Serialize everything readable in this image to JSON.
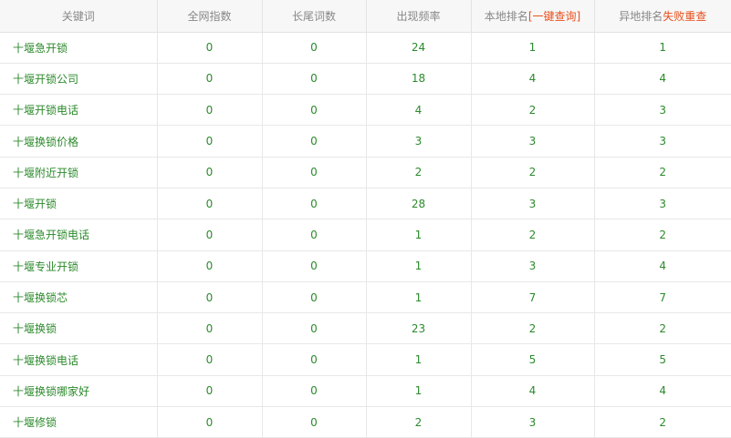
{
  "header": {
    "keyword": "关键词",
    "network_index": "全网指数",
    "longtail_count": "长尾词数",
    "frequency": "出现频率",
    "local_rank": "本地排名",
    "local_rank_link": "[一键查询]",
    "remote_rank": "异地排名",
    "remote_rank_link": "失败重查"
  },
  "colors": {
    "text": "#2c8a2c",
    "header_text": "#888888",
    "link": "#e8501c",
    "header_bg": "#f7f7f7"
  },
  "rows": [
    {
      "keyword": "十堰急开锁",
      "index": "0",
      "longtail": "0",
      "freq": "24",
      "local": "1",
      "remote": "1"
    },
    {
      "keyword": "十堰开锁公司",
      "index": "0",
      "longtail": "0",
      "freq": "18",
      "local": "4",
      "remote": "4"
    },
    {
      "keyword": "十堰开锁电话",
      "index": "0",
      "longtail": "0",
      "freq": "4",
      "local": "2",
      "remote": "3"
    },
    {
      "keyword": "十堰换锁价格",
      "index": "0",
      "longtail": "0",
      "freq": "3",
      "local": "3",
      "remote": "3"
    },
    {
      "keyword": "十堰附近开锁",
      "index": "0",
      "longtail": "0",
      "freq": "2",
      "local": "2",
      "remote": "2"
    },
    {
      "keyword": "十堰开锁",
      "index": "0",
      "longtail": "0",
      "freq": "28",
      "local": "3",
      "remote": "3"
    },
    {
      "keyword": "十堰急开锁电话",
      "index": "0",
      "longtail": "0",
      "freq": "1",
      "local": "2",
      "remote": "2"
    },
    {
      "keyword": "十堰专业开锁",
      "index": "0",
      "longtail": "0",
      "freq": "1",
      "local": "3",
      "remote": "4"
    },
    {
      "keyword": "十堰换锁芯",
      "index": "0",
      "longtail": "0",
      "freq": "1",
      "local": "7",
      "remote": "7"
    },
    {
      "keyword": "十堰换锁",
      "index": "0",
      "longtail": "0",
      "freq": "23",
      "local": "2",
      "remote": "2"
    },
    {
      "keyword": "十堰换锁电话",
      "index": "0",
      "longtail": "0",
      "freq": "1",
      "local": "5",
      "remote": "5"
    },
    {
      "keyword": "十堰换锁哪家好",
      "index": "0",
      "longtail": "0",
      "freq": "1",
      "local": "4",
      "remote": "4"
    },
    {
      "keyword": "十堰修锁",
      "index": "0",
      "longtail": "0",
      "freq": "2",
      "local": "3",
      "remote": "2"
    }
  ]
}
